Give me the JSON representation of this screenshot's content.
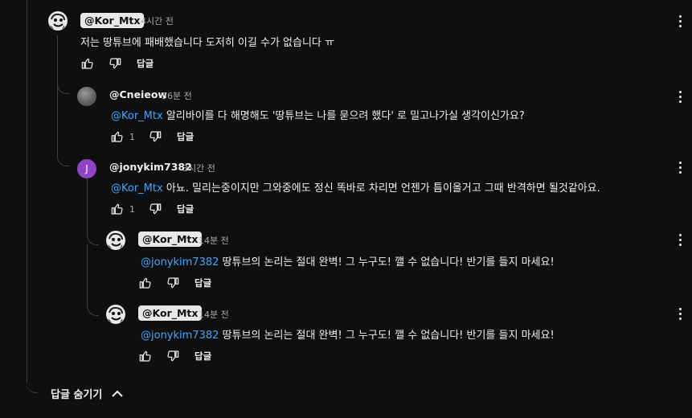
{
  "comments": [
    {
      "author": "@Kor_Mtx",
      "time": "4시간 전",
      "mention": "",
      "text": "저는 땅튜브에 패배했습니다 도저히 이길 수가 없습니다 ㅠ",
      "likes": "",
      "reply_label": "답글",
      "avatar": "smiling-face-sketch"
    },
    {
      "author": "@Cneieow",
      "time": "36분 전",
      "mention": "@Kor_Mtx",
      "text": " 알리바이를 다 해명해도 '땅튜브는 나를 묻으려 했다' 로 밀고나가실 생각이신가요?",
      "likes": "1",
      "reply_label": "답글",
      "avatar": "grey-sphere"
    },
    {
      "author": "@jonykim7382",
      "time": "3시간 전",
      "mention": "@Kor_Mtx",
      "text": " 아뇨. 밀리는중이지만 그와중에도 정신 똑바로 차리면 언젠가 틈이올거고 그때 반격하면 될것같아요.",
      "likes": "1",
      "reply_label": "답글",
      "avatar_letter": "J"
    },
    {
      "author": "@Kor_Mtx",
      "time": "14분 전",
      "mention": "@jonykim7382",
      "text": "  땅튜브의 논리는 절대 완벽! 그 누구도! 깰 수 없습니다! 반기를 들지 마세요!",
      "likes": "",
      "reply_label": "답글",
      "avatar": "smiling-face-sketch"
    },
    {
      "author": "@Kor_Mtx",
      "time": "14분 전",
      "mention": "@jonykim7382",
      "text": "  땅튜브의 논리는 절대 완벽! 그 누구도! 깰 수 없습니다! 반기를 들지 마세요!",
      "likes": "",
      "reply_label": "답글",
      "avatar": "smiling-face-sketch"
    }
  ],
  "hide_replies_label": "답글 숨기기",
  "colors": {
    "background": "#0f0f0f",
    "text": "#f1f1f1",
    "secondary": "#aaaaaa",
    "mention": "#3ea6ff",
    "chip": "#e8e8e8",
    "avatar_j": "#8e44c4"
  }
}
